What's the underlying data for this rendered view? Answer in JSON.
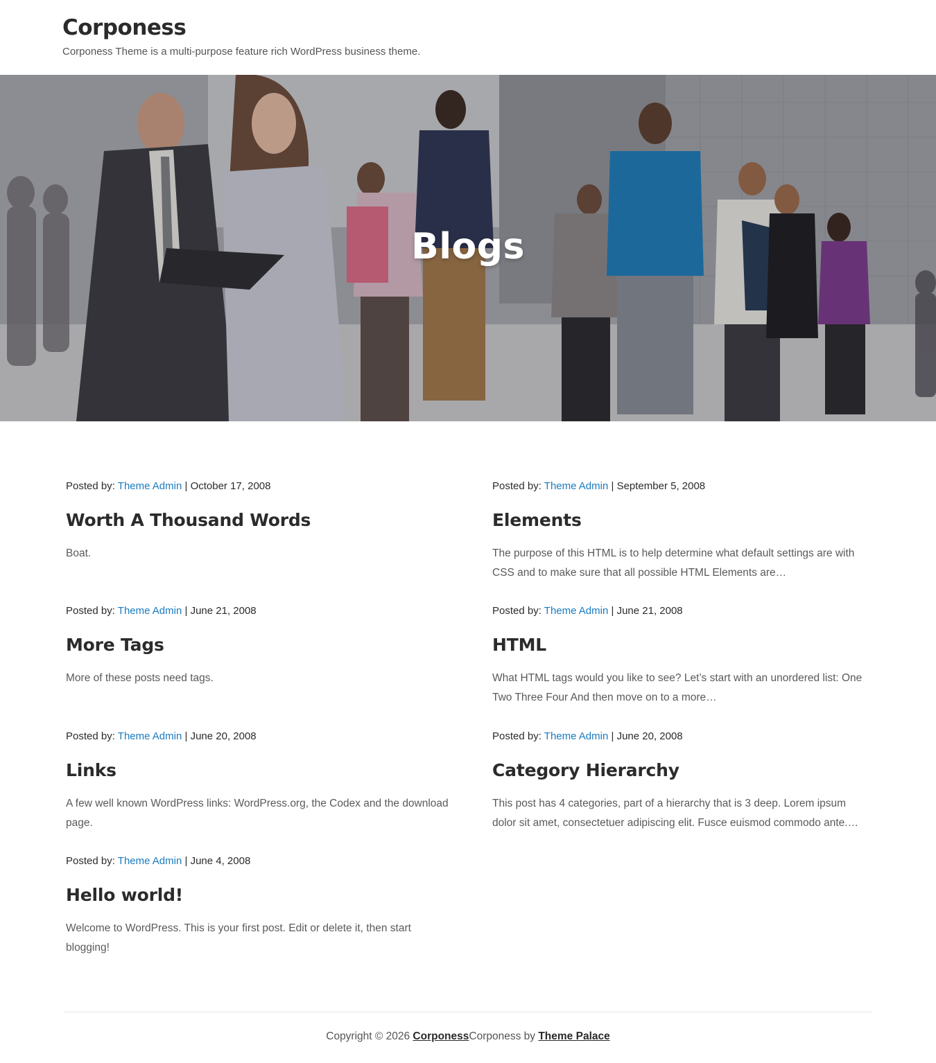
{
  "header": {
    "site_title": "Corponess",
    "tagline": "Corponess Theme is a multi-purpose feature rich WordPress business theme."
  },
  "hero": {
    "title": "Blogs"
  },
  "posts": [
    {
      "meta_prefix": "Posted by: ",
      "author": "Theme Admin",
      "separator": " | ",
      "date": "October 17, 2008",
      "title": "Worth A Thousand Words",
      "excerpt": "Boat."
    },
    {
      "meta_prefix": "Posted by: ",
      "author": "Theme Admin",
      "separator": " | ",
      "date": "September 5, 2008",
      "title": "Elements",
      "excerpt": "The purpose of this HTML is to help determine what default settings are with CSS and to make sure that all possible HTML Elements are…"
    },
    {
      "meta_prefix": "Posted by: ",
      "author": "Theme Admin",
      "separator": " | ",
      "date": "June 21, 2008",
      "title": "More Tags",
      "excerpt": "More of these posts need tags."
    },
    {
      "meta_prefix": "Posted by: ",
      "author": "Theme Admin",
      "separator": " | ",
      "date": "June 21, 2008",
      "title": "HTML",
      "excerpt": "What HTML tags would you like to see? Let’s start with an unordered list: One Two Three Four And then move on to a more…"
    },
    {
      "meta_prefix": "Posted by: ",
      "author": "Theme Admin",
      "separator": " | ",
      "date": "June 20, 2008",
      "title": "Links",
      "excerpt": "A few well known WordPress links: WordPress.org, the Codex and the download page."
    },
    {
      "meta_prefix": "Posted by: ",
      "author": "Theme Admin",
      "separator": " | ",
      "date": "June 20, 2008",
      "title": "Category Hierarchy",
      "excerpt": "This post has 4 categories, part of a hierarchy that is 3 deep. Lorem ipsum dolor sit amet, consectetuer adipiscing elit. Fusce euismod commodo ante.…"
    },
    {
      "meta_prefix": "Posted by: ",
      "author": "Theme Admin",
      "separator": " | ",
      "date": "June 4, 2008",
      "title": "Hello world!",
      "excerpt": "Welcome to WordPress. This is your first post. Edit or delete it, then start blogging!"
    }
  ],
  "footer": {
    "copyright_prefix": "Copyright © 2026 ",
    "site_link": "Corponess",
    "theme_by": "Corponess by ",
    "author_link": "Theme Palace"
  },
  "colors": {
    "link": "#1a7bbf",
    "heading": "#2b2b2b",
    "body_text": "#5a5a5a"
  }
}
